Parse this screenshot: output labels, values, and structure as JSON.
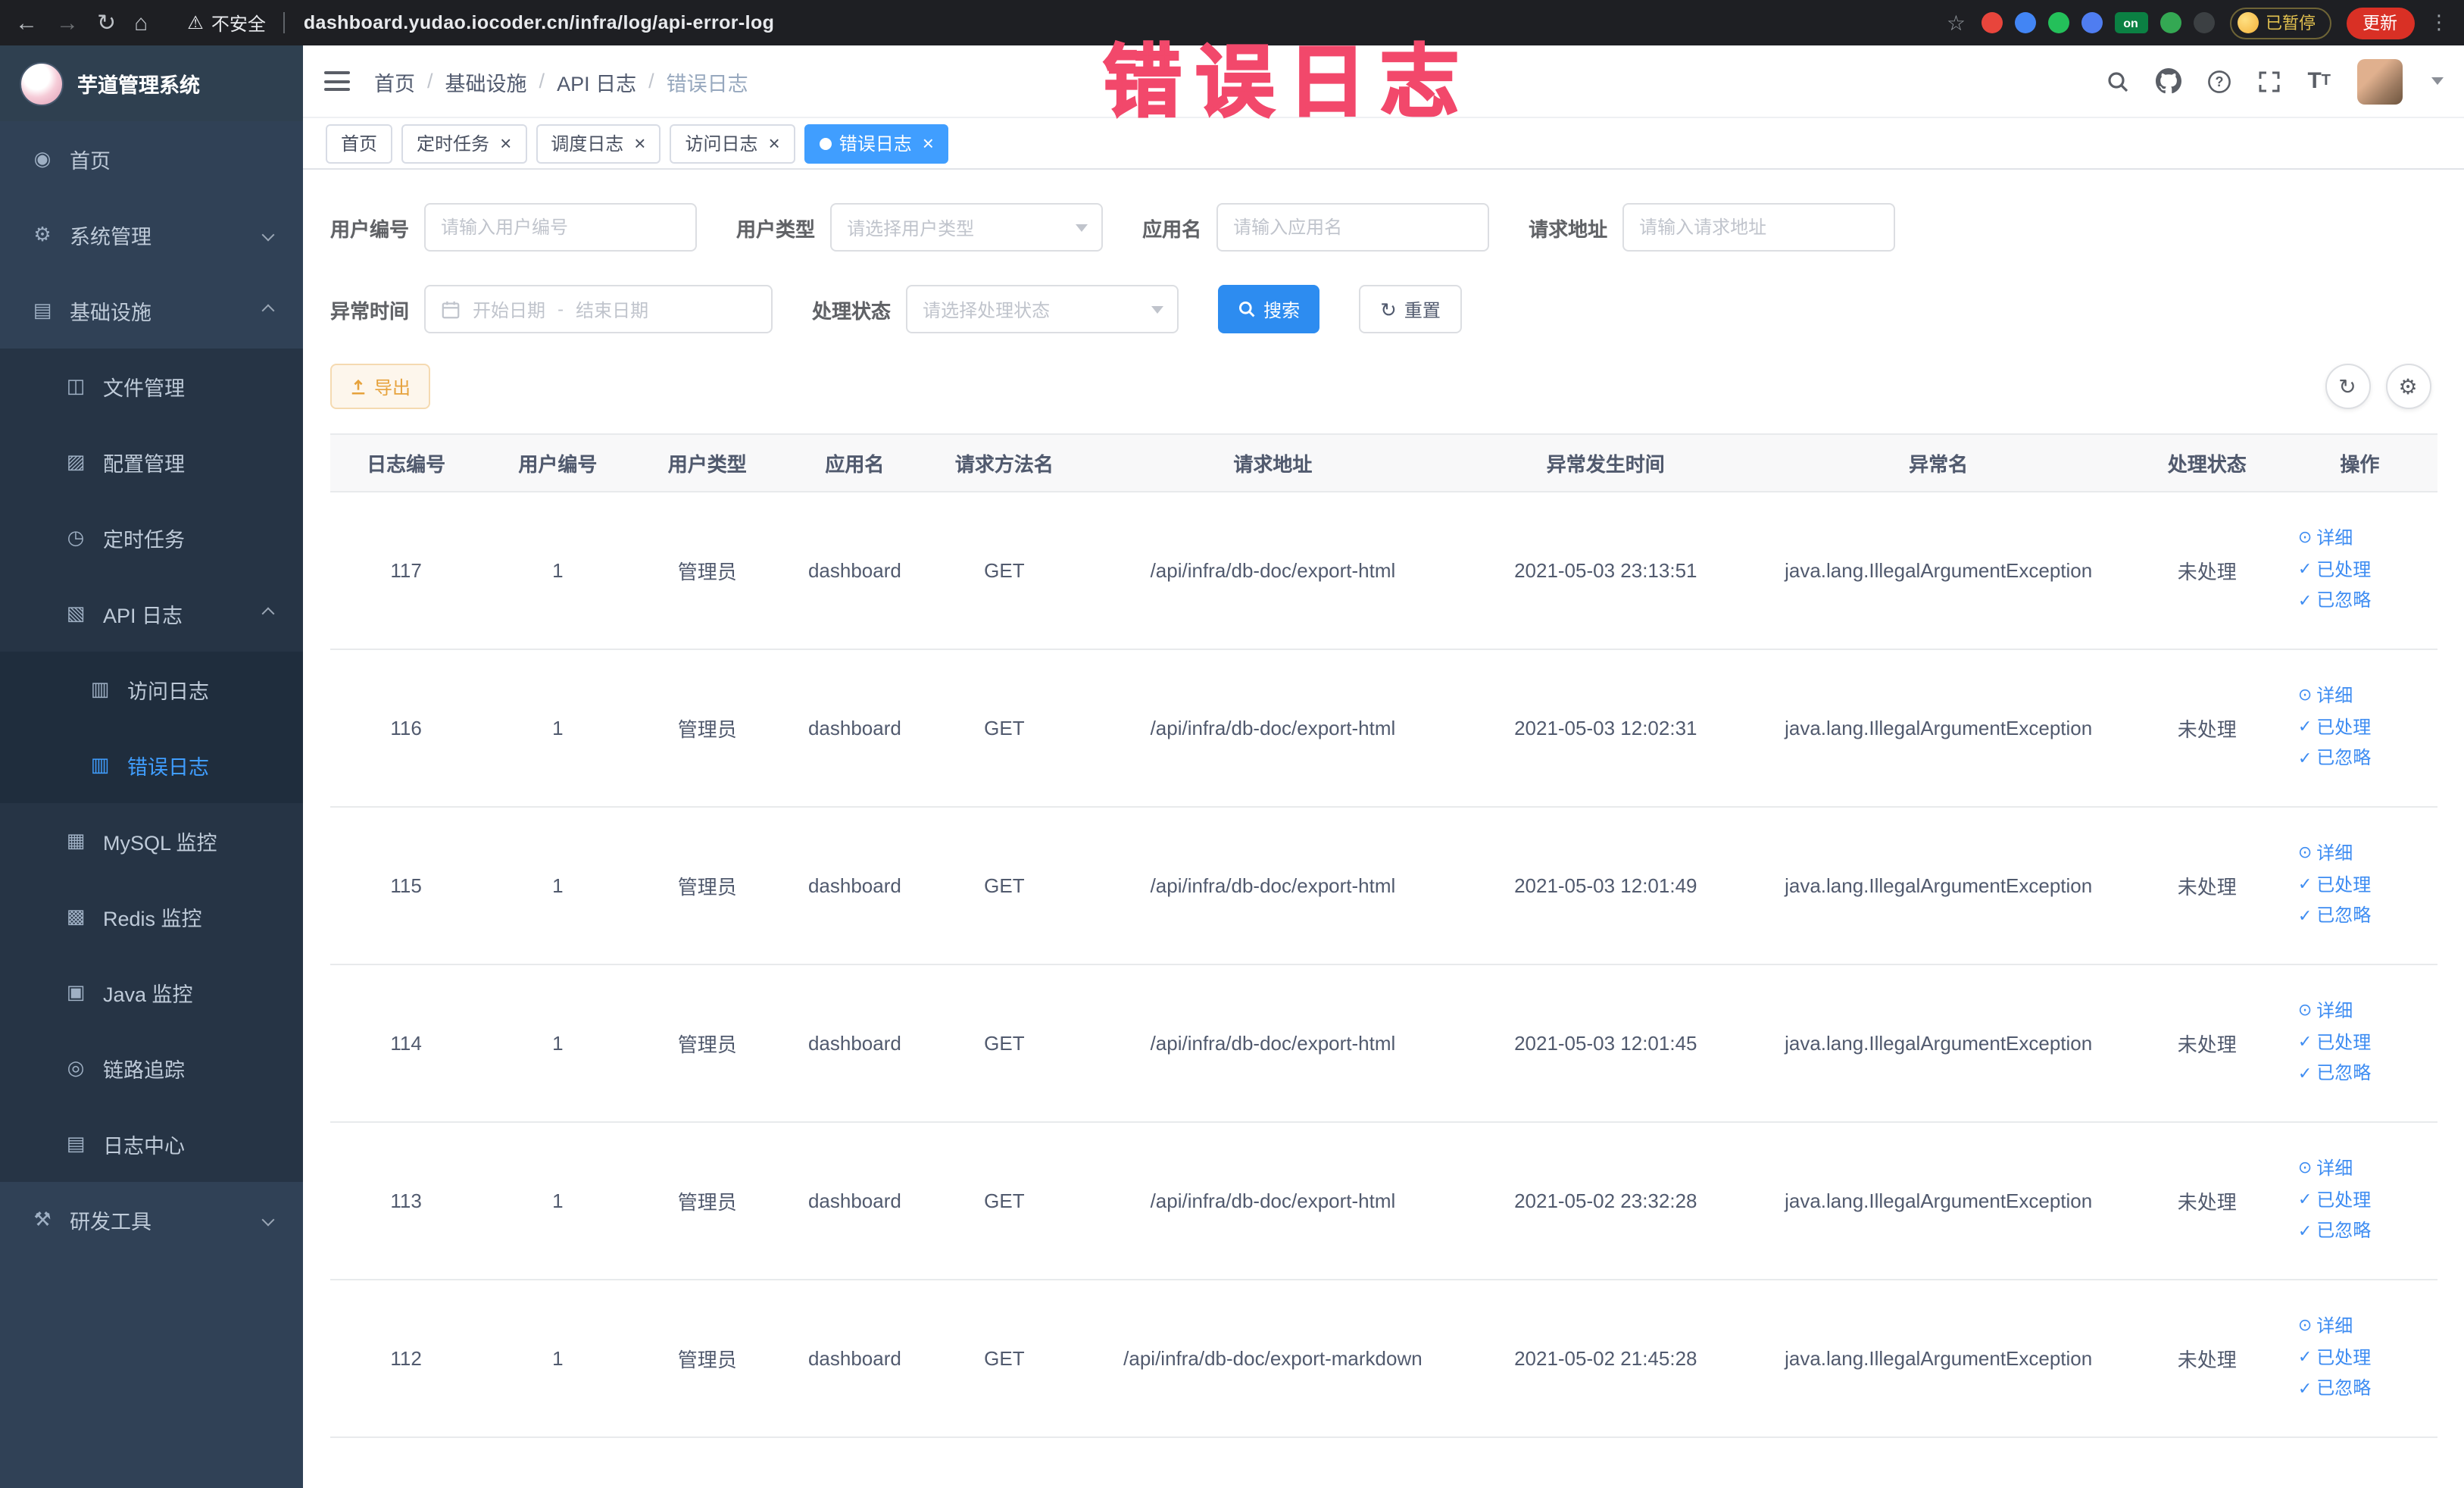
{
  "colors": {
    "primary": "#409eff",
    "active_tab": "#409eff",
    "warning": "#e6a23c",
    "annotation": "#f2486b",
    "sidebar_bg": "#304156",
    "sidebar_sub_bg": "#263445",
    "update_button_bg": "#d93025"
  },
  "browser": {
    "security_label": "不安全",
    "url": "dashboard.yudao.iocoder.cn/infra/log/api-error-log",
    "paused_badge": "已暂停",
    "update_button": "更新",
    "extensions": [
      {
        "key": "extension-red-circle-icon",
        "color": "#e8453c"
      },
      {
        "key": "extension-blue-drop-icon",
        "color": "#4285f4"
      },
      {
        "key": "extension-green-circle-icon",
        "color": "#24c05a"
      },
      {
        "key": "extension-blue-grid-icon",
        "color": "#4f7df0"
      },
      {
        "key": "extension-on-badge",
        "color": "#0b8043",
        "label": "on"
      },
      {
        "key": "extension-leaf-icon",
        "color": "#34a853"
      },
      {
        "key": "extension-paw-icon",
        "color": "#3c4043"
      }
    ]
  },
  "annotation": {
    "text": "错误日志"
  },
  "sidebar": {
    "logo_title": "芋道管理系统",
    "items": [
      {
        "key": "home",
        "label": "首页",
        "icon": "home-icon",
        "glyph": "◉"
      },
      {
        "key": "system",
        "label": "系统管理",
        "icon": "gear-icon",
        "glyph": "⚙",
        "expandable": true,
        "expanded": false
      },
      {
        "key": "infrastructure",
        "label": "基础设施",
        "icon": "infrastructure-icon",
        "glyph": "▤",
        "expandable": true,
        "expanded": true,
        "children": [
          {
            "key": "file",
            "label": "文件管理",
            "icon": "file-icon",
            "glyph": "◫"
          },
          {
            "key": "config",
            "label": "配置管理",
            "icon": "config-edit-icon",
            "glyph": "▨"
          },
          {
            "key": "job",
            "label": "定时任务",
            "icon": "schedule-icon",
            "glyph": "◷"
          },
          {
            "key": "api-log",
            "label": "API 日志",
            "icon": "api-log-icon",
            "glyph": "▧",
            "expandable": true,
            "expanded": true,
            "children": [
              {
                "key": "access-log",
                "label": "访问日志",
                "icon": "access-log-icon",
                "glyph": "▥"
              },
              {
                "key": "error-log",
                "label": "错误日志",
                "icon": "error-log-icon",
                "glyph": "▥",
                "active": true
              }
            ]
          },
          {
            "key": "mysql",
            "label": "MySQL 监控",
            "icon": "mysql-monitor-icon",
            "glyph": "▦"
          },
          {
            "key": "redis",
            "label": "Redis 监控",
            "icon": "redis-monitor-icon",
            "glyph": "▩"
          },
          {
            "key": "java",
            "label": "Java 监控",
            "icon": "java-monitor-icon",
            "glyph": "▣"
          },
          {
            "key": "trace",
            "label": "链路追踪",
            "icon": "trace-eye-icon",
            "glyph": "◎"
          },
          {
            "key": "log-center",
            "label": "日志中心",
            "icon": "log-center-icon",
            "glyph": "▤"
          }
        ]
      },
      {
        "key": "devtools",
        "label": "研发工具",
        "icon": "devtools-icon",
        "glyph": "⚒",
        "expandable": true,
        "expanded": false
      }
    ]
  },
  "header": {
    "breadcrumb": [
      "首页",
      "基础设施",
      "API 日志",
      "错误日志"
    ],
    "breadcrumb_separator": "/"
  },
  "tabs": [
    {
      "key": "home",
      "label": "首页",
      "closable": false,
      "active": false
    },
    {
      "key": "job",
      "label": "定时任务",
      "closable": true,
      "active": false
    },
    {
      "key": "job-log",
      "label": "调度日志",
      "closable": true,
      "active": false
    },
    {
      "key": "access-log",
      "label": "访问日志",
      "closable": true,
      "active": false
    },
    {
      "key": "error-log",
      "label": "错误日志",
      "closable": true,
      "active": true
    }
  ],
  "filters": {
    "user_id": {
      "label": "用户编号",
      "placeholder": "请输入用户编号"
    },
    "user_type": {
      "label": "用户类型",
      "placeholder": "请选择用户类型"
    },
    "app_name": {
      "label": "应用名",
      "placeholder": "请输入应用名"
    },
    "request_url": {
      "label": "请求地址",
      "placeholder": "请输入请求地址"
    },
    "exception_time": {
      "label": "异常时间",
      "start_placeholder": "开始日期",
      "separator": "-",
      "end_placeholder": "结束日期"
    },
    "process_status": {
      "label": "处理状态",
      "placeholder": "请选择处理状态"
    },
    "search_button": "搜索",
    "reset_button": "重置"
  },
  "toolbar": {
    "export_button": "导出"
  },
  "table": {
    "columns": [
      "日志编号",
      "用户编号",
      "用户类型",
      "应用名",
      "请求方法名",
      "请求地址",
      "异常发生时间",
      "异常名",
      "处理状态",
      "操作"
    ],
    "actions": [
      {
        "key": "detail",
        "label": "详细",
        "icon": "detail-eye-icon",
        "glyph": "⊙"
      },
      {
        "key": "processed",
        "label": "已处理",
        "icon": "processed-check-icon",
        "glyph": "✓"
      },
      {
        "key": "ignored",
        "label": "已忽略",
        "icon": "ignored-check-icon",
        "glyph": "✓"
      }
    ],
    "rows": [
      {
        "log_id": "117",
        "user_id": "1",
        "user_type": "管理员",
        "app_name": "dashboard",
        "method": "GET",
        "url": "/api/infra/db-doc/export-html",
        "time": "2021-05-03 23:13:51",
        "exception": "java.lang.IllegalArgumentException",
        "status": "未处理"
      },
      {
        "log_id": "116",
        "user_id": "1",
        "user_type": "管理员",
        "app_name": "dashboard",
        "method": "GET",
        "url": "/api/infra/db-doc/export-html",
        "time": "2021-05-03 12:02:31",
        "exception": "java.lang.IllegalArgumentException",
        "status": "未处理"
      },
      {
        "log_id": "115",
        "user_id": "1",
        "user_type": "管理员",
        "app_name": "dashboard",
        "method": "GET",
        "url": "/api/infra/db-doc/export-html",
        "time": "2021-05-03 12:01:49",
        "exception": "java.lang.IllegalArgumentException",
        "status": "未处理"
      },
      {
        "log_id": "114",
        "user_id": "1",
        "user_type": "管理员",
        "app_name": "dashboard",
        "method": "GET",
        "url": "/api/infra/db-doc/export-html",
        "time": "2021-05-03 12:01:45",
        "exception": "java.lang.IllegalArgumentException",
        "status": "未处理"
      },
      {
        "log_id": "113",
        "user_id": "1",
        "user_type": "管理员",
        "app_name": "dashboard",
        "method": "GET",
        "url": "/api/infra/db-doc/export-html",
        "time": "2021-05-02 23:32:28",
        "exception": "java.lang.IllegalArgumentException",
        "status": "未处理"
      },
      {
        "log_id": "112",
        "user_id": "1",
        "user_type": "管理员",
        "app_name": "dashboard",
        "method": "GET",
        "url": "/api/infra/db-doc/export-markdown",
        "time": "2021-05-02 21:45:28",
        "exception": "java.lang.IllegalArgumentException",
        "status": "未处理"
      }
    ]
  }
}
